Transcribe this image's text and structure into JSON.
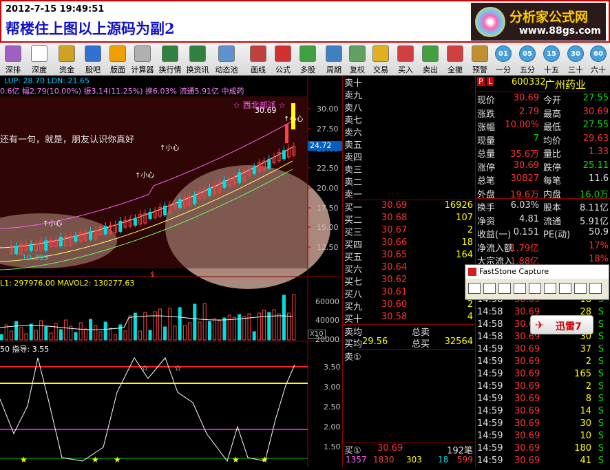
{
  "header": {
    "datetime": "2012-7-15 19:49:51",
    "title": "帮楼住上图以上源码为副2"
  },
  "logo": {
    "name": "分析家公式网",
    "url": "www.88gs.com"
  },
  "toolbar": [
    {
      "label": "深排",
      "icon": "bars-icon",
      "color": "#a060c0"
    },
    {
      "label": "深度",
      "icon": "f9-icon",
      "color": "#ffffff"
    },
    {
      "label": "资金",
      "icon": "money-icon",
      "color": "#d0a020"
    },
    {
      "label": "股吧",
      "icon": "people-icon",
      "color": "#3070d0"
    },
    {
      "label": "版面",
      "icon": "l2-icon",
      "color": "#f0a000"
    },
    {
      "label": "计算器",
      "icon": "calculator-icon",
      "color": "#b0b0b0"
    },
    {
      "label": "换行情",
      "icon": "chart-swap-icon",
      "color": "#308040"
    },
    {
      "label": "换资讯",
      "icon": "info-swap-icon",
      "color": "#308040"
    },
    {
      "label": "动态池",
      "icon": "pool-icon",
      "color": "#6090d0"
    },
    {
      "label": "画线",
      "icon": "pen-icon",
      "color": "#c04040"
    },
    {
      "label": "公式",
      "icon": "formula-icon",
      "color": "#d03030"
    },
    {
      "label": "多股",
      "icon": "multi-chart-icon",
      "color": "#40a040"
    },
    {
      "label": "周期",
      "icon": "cycle-icon",
      "color": "#4080c0"
    },
    {
      "label": "复权",
      "icon": "restore-icon",
      "color": "#60a060"
    },
    {
      "label": "交易",
      "icon": "trade-icon",
      "color": "#e0b020"
    },
    {
      "label": "买入",
      "icon": "buy-icon",
      "color": "#d04040"
    },
    {
      "label": "卖出",
      "icon": "sell-icon",
      "color": "#40a040"
    },
    {
      "label": "全撤",
      "icon": "cancel-all-icon",
      "color": "#d04040"
    },
    {
      "label": "预警",
      "icon": "grid-icon",
      "color": "#c09030"
    }
  ],
  "periods": [
    {
      "num": "01",
      "label": "一分"
    },
    {
      "num": "05",
      "label": "五分"
    },
    {
      "num": "15",
      "label": "十五"
    },
    {
      "num": "30",
      "label": "三十"
    },
    {
      "num": "60",
      "label": "六十"
    }
  ],
  "chart": {
    "legend": "LUP: 28.70  LDN: 21.65",
    "info1": "0.6亿 幅2.79(10.00%) 振3.14(11.25%) 换6.03% 流通5.91亿 中成药",
    "overlay_text": "还有一句，就是，朋友认识你真好",
    "stock_name": "西北部派",
    "high_label": "30.69",
    "low_label": "10.399",
    "price_tag": "24.72",
    "price_axis": [
      "30.00",
      "27.50",
      "25.00",
      "22.50",
      "20.00",
      "17.50",
      "15.00",
      "12.50"
    ],
    "marker": "$",
    "vol_legend": "L1: 297976.00   MAVOL2: 130277.63",
    "vol_axis": [
      "60000",
      "40000",
      "20000"
    ],
    "vol_unit": "X10",
    "ind_legend": "50  指导: 3.55",
    "ind_axis": [
      "3.50",
      "3.00",
      "2.50",
      "2.00",
      "1.50"
    ],
    "tag_small": "小心"
  },
  "orderbook": {
    "sells": [
      "卖十",
      "卖九",
      "卖八",
      "卖七",
      "卖六",
      "卖五",
      "卖四",
      "卖三",
      "卖二",
      "卖一"
    ],
    "buys": [
      {
        "label": "买一",
        "price": "30.69",
        "vol": "16926"
      },
      {
        "label": "买二",
        "price": "30.68",
        "vol": "107"
      },
      {
        "label": "买三",
        "price": "30.67",
        "vol": "2"
      },
      {
        "label": "买四",
        "price": "30.66",
        "vol": "18"
      },
      {
        "label": "买五",
        "price": "30.65",
        "vol": "164"
      },
      {
        "label": "买六",
        "price": "30.64",
        "vol": ""
      },
      {
        "label": "买七",
        "price": "30.62",
        "vol": ""
      },
      {
        "label": "买八",
        "price": "30.61",
        "vol": ""
      },
      {
        "label": "买九",
        "price": "30.60",
        "vol": "2"
      },
      {
        "label": "买十",
        "price": "30.58",
        "vol": "4"
      }
    ],
    "avg_sell": "卖均",
    "avg_sell_right": "总卖",
    "avg_buy": "买均",
    "avg_buy_price": "29.56",
    "avg_buy_right": "总买",
    "total_buy": "32564",
    "sell1_circ": "卖①",
    "buy1_circ": "买①",
    "buy1_price": "30.69",
    "buy1_vol": "192笔",
    "bottom": [
      "1357",
      "1830",
      "303",
      "18",
      "599"
    ]
  },
  "quote": {
    "code": "600332",
    "name": "广州药业",
    "rows": [
      [
        "现价",
        "30.69",
        "今开",
        "27.55"
      ],
      [
        "涨跌",
        "2.79",
        "最高",
        "30.69"
      ],
      [
        "涨幅",
        "10.00%",
        "最低",
        "27.55"
      ],
      [
        "现量",
        "7",
        "均价",
        "29.63"
      ],
      [
        "总量",
        "35.6万",
        "量比",
        "1.33"
      ],
      [
        "涨停",
        "30.69",
        "跌停",
        "25.11"
      ],
      [
        "总笔",
        "30827",
        "每笔",
        "11.6"
      ],
      [
        "外盘",
        "19.6万",
        "内盘",
        "16.0万"
      ],
      [
        "换手",
        "6.03%",
        "股本",
        "8.11亿"
      ],
      [
        "净资",
        "4.81",
        "流通",
        "5.91亿"
      ],
      [
        "收益(一)",
        "0.151",
        "PE(动)",
        "50.9"
      ],
      [
        "净流入额",
        "1.79亿",
        "",
        "17%"
      ],
      [
        "大宗流入",
        "1.88亿",
        "",
        "18%"
      ]
    ],
    "ticks": [
      [
        "14:58",
        "30.69",
        "18",
        "S"
      ],
      [
        "14:58",
        "30.69",
        "28",
        "S"
      ],
      [
        "14:58",
        "30.69",
        "",
        "S"
      ],
      [
        "14:58",
        "30.69",
        "30",
        "S"
      ],
      [
        "14:59",
        "30.69",
        "37",
        "S"
      ],
      [
        "14:59",
        "30.69",
        "2",
        "S"
      ],
      [
        "14:59",
        "30.69",
        "165",
        "S"
      ],
      [
        "14:59",
        "30.69",
        "2",
        "S"
      ],
      [
        "14:59",
        "30.69",
        "8",
        "S"
      ],
      [
        "14:59",
        "30.69",
        "14",
        "S"
      ],
      [
        "14:59",
        "30.69",
        "30",
        "S"
      ],
      [
        "14:59",
        "30.69",
        "10",
        "S"
      ],
      [
        "14:59",
        "30.69",
        "180",
        "S"
      ],
      [
        "14:59",
        "30.69",
        "41",
        "S"
      ]
    ]
  },
  "fastsone": {
    "title": "FastStone Capture"
  },
  "xunlei": {
    "label": "迅雷7"
  }
}
